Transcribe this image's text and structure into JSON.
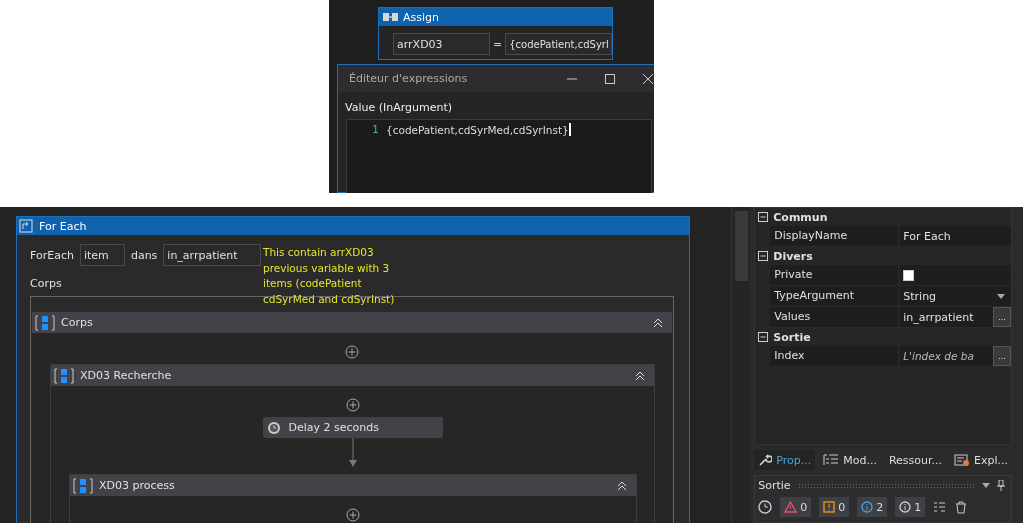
{
  "assign": {
    "title": "Assign",
    "to": "arrXD03",
    "operator": "=",
    "value": "{codePatient,cdSyrl"
  },
  "expression_editor": {
    "title": "Éditeur d'expressions",
    "label": "Value (InArgument)",
    "lines": [
      {
        "number": "1",
        "text": "{codePatient,cdSyrMed,cdSyrInst}"
      }
    ]
  },
  "foreach": {
    "title": "For Each",
    "keyword": "ForEach",
    "item": "item",
    "in_label": "dans",
    "values": "in_arrpatient",
    "annotation": [
      "This contain arrXD03",
      "previous variable with 3",
      "items (codePatient",
      "cdSyrMed and cdSyrInst)"
    ],
    "body_label": "Corps",
    "body": {
      "kind": "sequence",
      "title": "Corps",
      "expanded": true,
      "children": [
        {
          "kind": "sequence",
          "title": "XD03 Recherche",
          "expanded": true,
          "children": [
            {
              "kind": "delay",
              "title": "Delay 2 seconds"
            },
            {
              "kind": "sequence",
              "title": "XD03 process",
              "expanded": true
            }
          ]
        }
      ]
    }
  },
  "properties": {
    "sections": [
      {
        "title": "Commun",
        "expanded": true,
        "rows": [
          {
            "name": "DisplayName",
            "kind": "text",
            "value": "For Each"
          }
        ]
      },
      {
        "title": "Divers",
        "expanded": true,
        "rows": [
          {
            "name": "Private",
            "kind": "checkbox",
            "checked": false
          },
          {
            "name": "TypeArgument",
            "kind": "dropdown",
            "value": "String"
          },
          {
            "name": "Values",
            "kind": "button",
            "value": "in_arrpatient",
            "button": "..."
          }
        ]
      },
      {
        "title": "Sortie",
        "expanded": true,
        "rows": [
          {
            "name": "Index",
            "kind": "button",
            "placeholder": "L'index de ba",
            "button": "..."
          }
        ]
      }
    ]
  },
  "tabs": [
    {
      "label": "Prop...",
      "selected": true
    },
    {
      "label": "Mod...",
      "selected": false
    },
    {
      "label": "Ressour...",
      "selected": false
    },
    {
      "label": "Expl...",
      "selected": false
    }
  ],
  "output": {
    "title": "Sortie",
    "filters": [
      {
        "kind": "error",
        "count": "0"
      },
      {
        "kind": "warning",
        "count": "0"
      },
      {
        "kind": "info",
        "count": "2"
      },
      {
        "kind": "verbose",
        "count": "1"
      }
    ]
  }
}
